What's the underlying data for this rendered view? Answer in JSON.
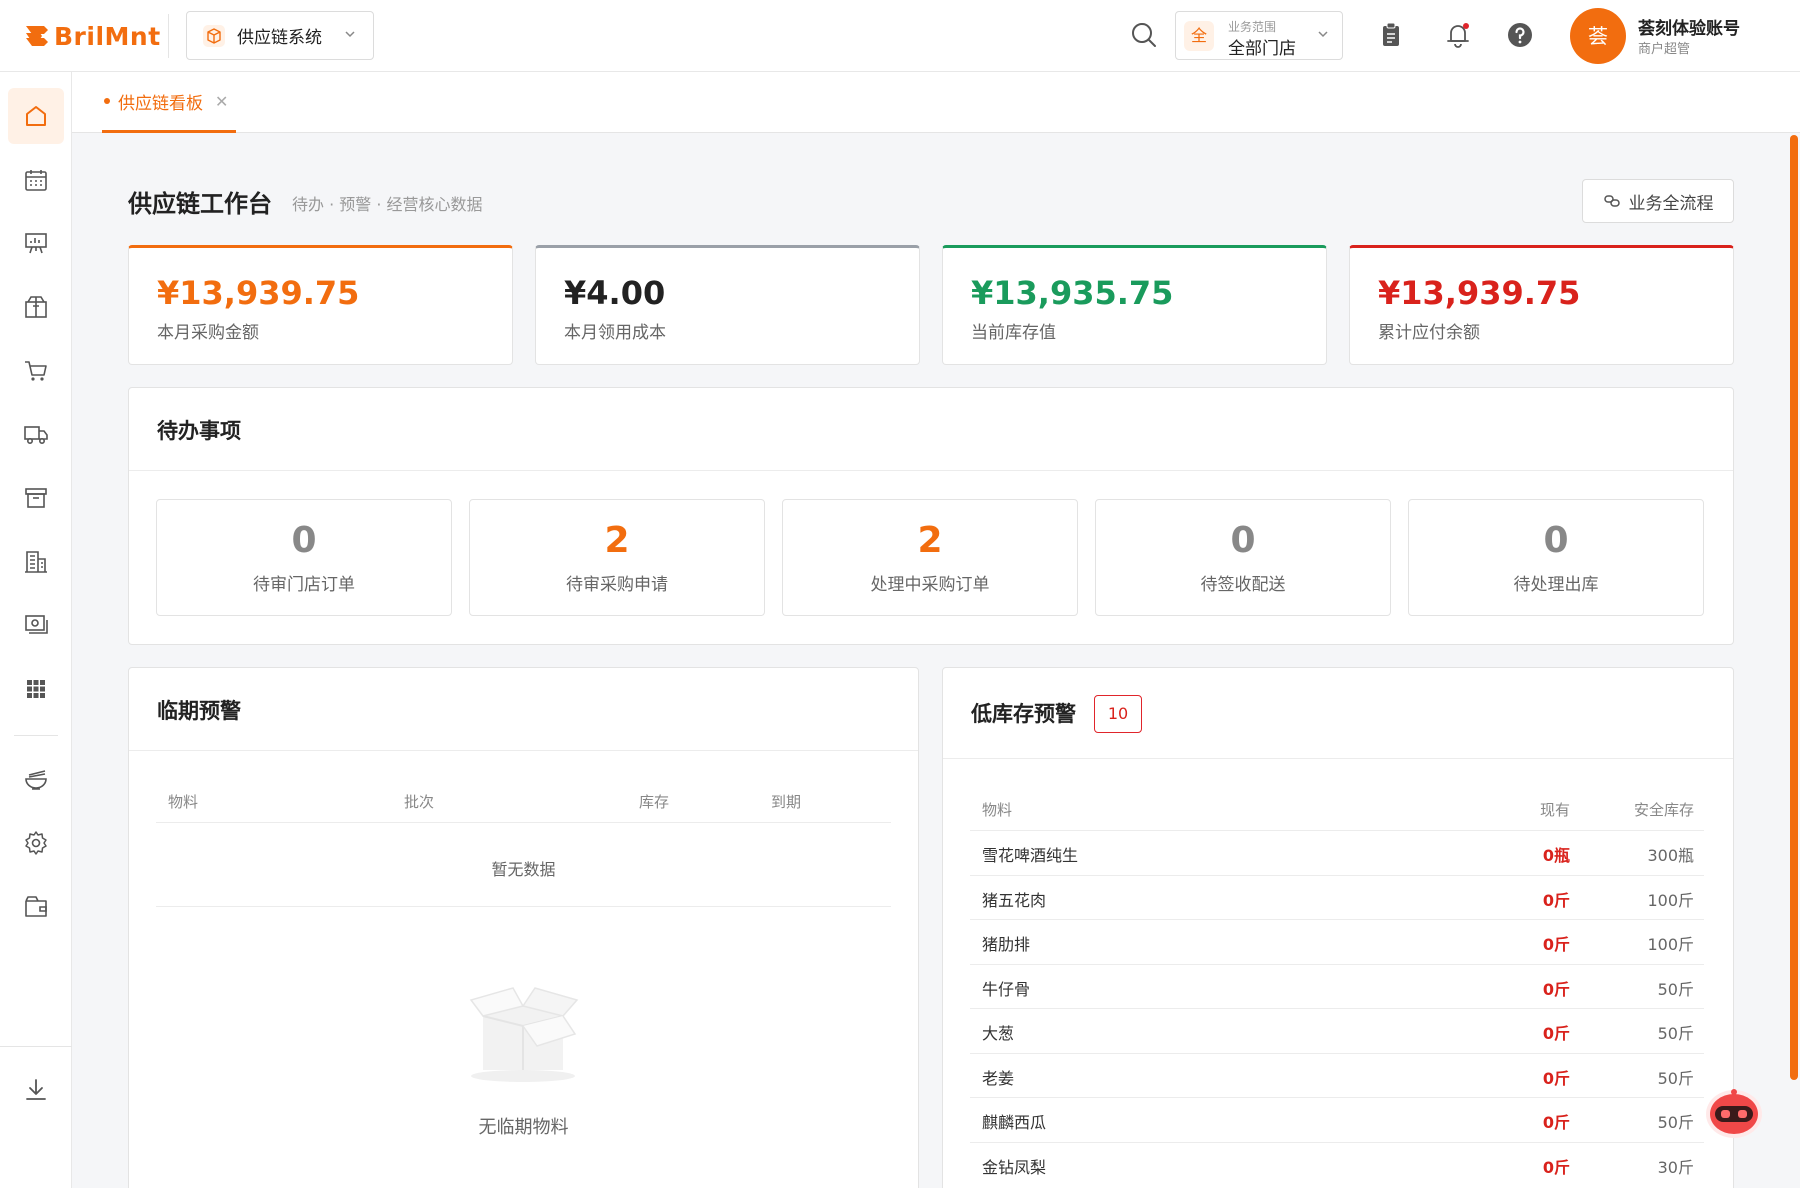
{
  "header": {
    "logo_text": "BrilMnt",
    "system_select": "供应链系统",
    "scope_label": "业务范围",
    "scope_value": "全部门店",
    "scope_badge": "全",
    "user_avatar": "荟",
    "user_name": "荟刻体验账号",
    "user_role": "商户超管"
  },
  "tabs": [
    {
      "label": "供应链看板"
    }
  ],
  "page": {
    "title": "供应链工作台",
    "subtitle": "待办 · 预警 · 经营核心数据",
    "flow_button": "业务全流程"
  },
  "stats": [
    {
      "value": "¥13,939.75",
      "label": "本月采购金额",
      "color": "#f26d0f"
    },
    {
      "value": "¥4.00",
      "label": "本月领用成本",
      "color": "#222222"
    },
    {
      "value": "¥13,935.75",
      "label": "当前库存值",
      "color": "#1a9b5c"
    },
    {
      "value": "¥13,939.75",
      "label": "累计应付余额",
      "color": "#d9221c"
    }
  ],
  "todo": {
    "title": "待办事项",
    "items": [
      {
        "count": "0",
        "label": "待审门店订单"
      },
      {
        "count": "2",
        "label": "待审采购申请"
      },
      {
        "count": "2",
        "label": "处理中采购订单"
      },
      {
        "count": "0",
        "label": "待签收配送"
      },
      {
        "count": "0",
        "label": "待处理出库"
      }
    ]
  },
  "expiry": {
    "title": "临期预警",
    "columns": [
      "物料",
      "批次",
      "库存",
      "到期"
    ],
    "empty_row": "暂无数据",
    "empty_text": "无临期物料"
  },
  "low_stock": {
    "title": "低库存预警",
    "count": "10",
    "columns": [
      "物料",
      "现有",
      "安全库存"
    ],
    "rows": [
      {
        "name": "雪花啤酒纯生",
        "current": "0瓶",
        "safety": "300瓶"
      },
      {
        "name": "猪五花肉",
        "current": "0斤",
        "safety": "100斤"
      },
      {
        "name": "猪肋排",
        "current": "0斤",
        "safety": "100斤"
      },
      {
        "name": "牛仔骨",
        "current": "0斤",
        "safety": "50斤"
      },
      {
        "name": "大葱",
        "current": "0斤",
        "safety": "50斤"
      },
      {
        "name": "老姜",
        "current": "0斤",
        "safety": "50斤"
      },
      {
        "name": "麒麟西瓜",
        "current": "0斤",
        "safety": "50斤"
      },
      {
        "name": "金钻凤梨",
        "current": "0斤",
        "safety": "30斤"
      }
    ]
  },
  "colors": {
    "accent": "#f26d0f",
    "danger": "#d9221c",
    "success": "#1a9b5c"
  }
}
